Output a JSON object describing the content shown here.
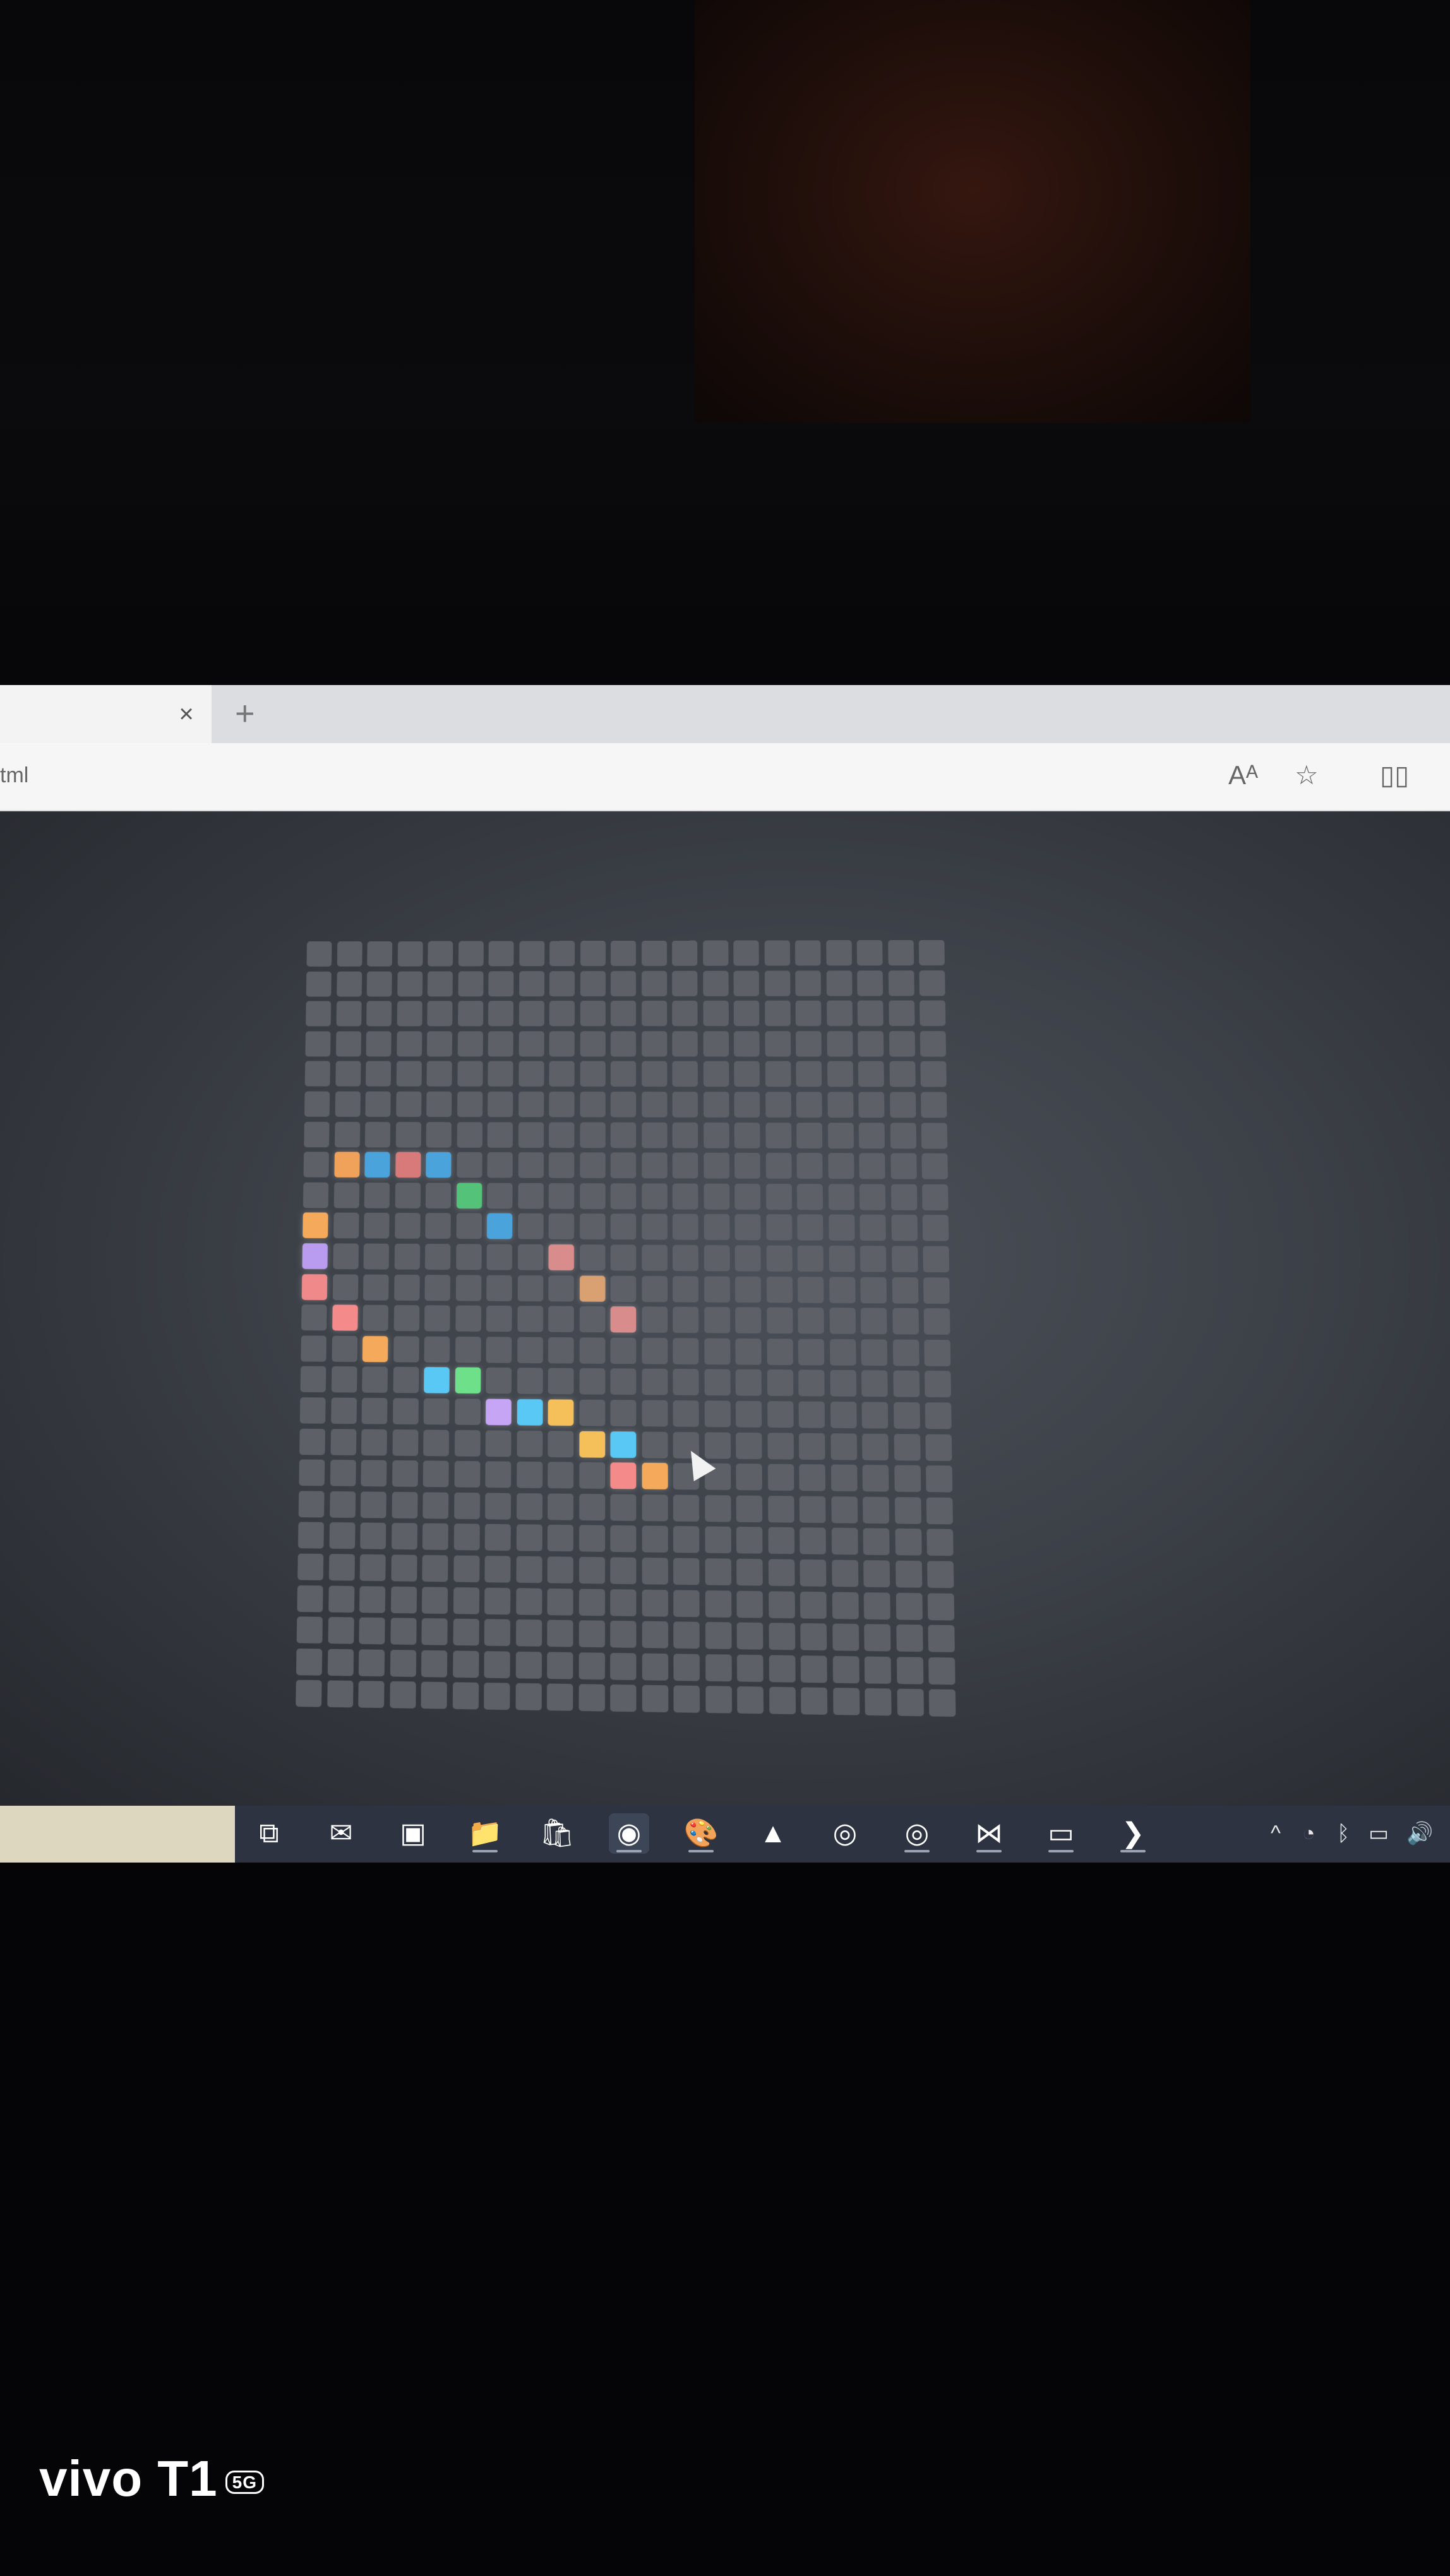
{
  "browser": {
    "tab_close_glyph": "×",
    "new_tab_glyph": "+",
    "url_fragment": "tml",
    "icons": [
      "read-aloud-icon",
      "favorite-star-icon",
      "split-screen-icon"
    ],
    "read_aloud_glyph": "Aᴬ",
    "favorite_glyph": "☆",
    "split_glyph": "▯▯"
  },
  "game": {
    "grid_columns": 21,
    "grid_rows": 25,
    "empty_cell_color": "#5d6167",
    "lit_cells": [
      {
        "col": 1,
        "row": 7,
        "color": "#f0a15a"
      },
      {
        "col": 2,
        "row": 7,
        "color": "#4aa3db"
      },
      {
        "col": 3,
        "row": 7,
        "color": "#d97a7a"
      },
      {
        "col": 4,
        "row": 7,
        "color": "#4aa3db"
      },
      {
        "col": 5,
        "row": 8,
        "color": "#55c27a"
      },
      {
        "col": 0,
        "row": 9,
        "color": "#f5a95a"
      },
      {
        "col": 6,
        "row": 9,
        "color": "#4aa3db"
      },
      {
        "col": 0,
        "row": 10,
        "color": "#b99cf0"
      },
      {
        "col": 8,
        "row": 10,
        "color": "#d98c8c"
      },
      {
        "col": 0,
        "row": 11,
        "color": "#f08a8a"
      },
      {
        "col": 9,
        "row": 11,
        "color": "#d9a072"
      },
      {
        "col": 1,
        "row": 12,
        "color": "#f58a8a"
      },
      {
        "col": 10,
        "row": 12,
        "color": "#d98c8c"
      },
      {
        "col": 2,
        "row": 13,
        "color": "#f5a95a"
      },
      {
        "col": 4,
        "row": 14,
        "color": "#5ac8f5"
      },
      {
        "col": 5,
        "row": 14,
        "color": "#6ee08a"
      },
      {
        "col": 6,
        "row": 15,
        "color": "#c6a5f5"
      },
      {
        "col": 7,
        "row": 15,
        "color": "#5ac8f5"
      },
      {
        "col": 8,
        "row": 15,
        "color": "#f5c05a"
      },
      {
        "col": 9,
        "row": 16,
        "color": "#f5c05a"
      },
      {
        "col": 10,
        "row": 16,
        "color": "#5ac8f5"
      },
      {
        "col": 10,
        "row": 17,
        "color": "#f58a8a"
      },
      {
        "col": 11,
        "row": 17,
        "color": "#f5a95a"
      }
    ]
  },
  "taskbar": {
    "apps": [
      {
        "name": "task-view-icon",
        "glyph": "⧉"
      },
      {
        "name": "mail-icon",
        "glyph": "✉"
      },
      {
        "name": "remote-desktop-icon",
        "glyph": "▣"
      },
      {
        "name": "file-explorer-icon",
        "glyph": "📁"
      },
      {
        "name": "store-icon",
        "glyph": "🛍"
      },
      {
        "name": "edge-browser-icon",
        "glyph": "◉"
      },
      {
        "name": "paint-icon",
        "glyph": "🎨"
      },
      {
        "name": "vlc-icon",
        "glyph": "▲"
      },
      {
        "name": "chrome-icon",
        "glyph": "◎"
      },
      {
        "name": "chrome-profile-icon",
        "glyph": "◎"
      },
      {
        "name": "vscode-icon",
        "glyph": "⋈"
      },
      {
        "name": "terminal-icon",
        "glyph": "▭"
      },
      {
        "name": "powershell-icon",
        "glyph": "❯"
      }
    ],
    "tray": {
      "chevron_glyph": "^",
      "wifi_glyph": "◔",
      "bluetooth_glyph": "ᛒ",
      "battery_glyph": "▭",
      "volume_glyph": "🔊"
    }
  },
  "camera_watermark": {
    "brand": "vivo T1",
    "badge": "5G"
  }
}
